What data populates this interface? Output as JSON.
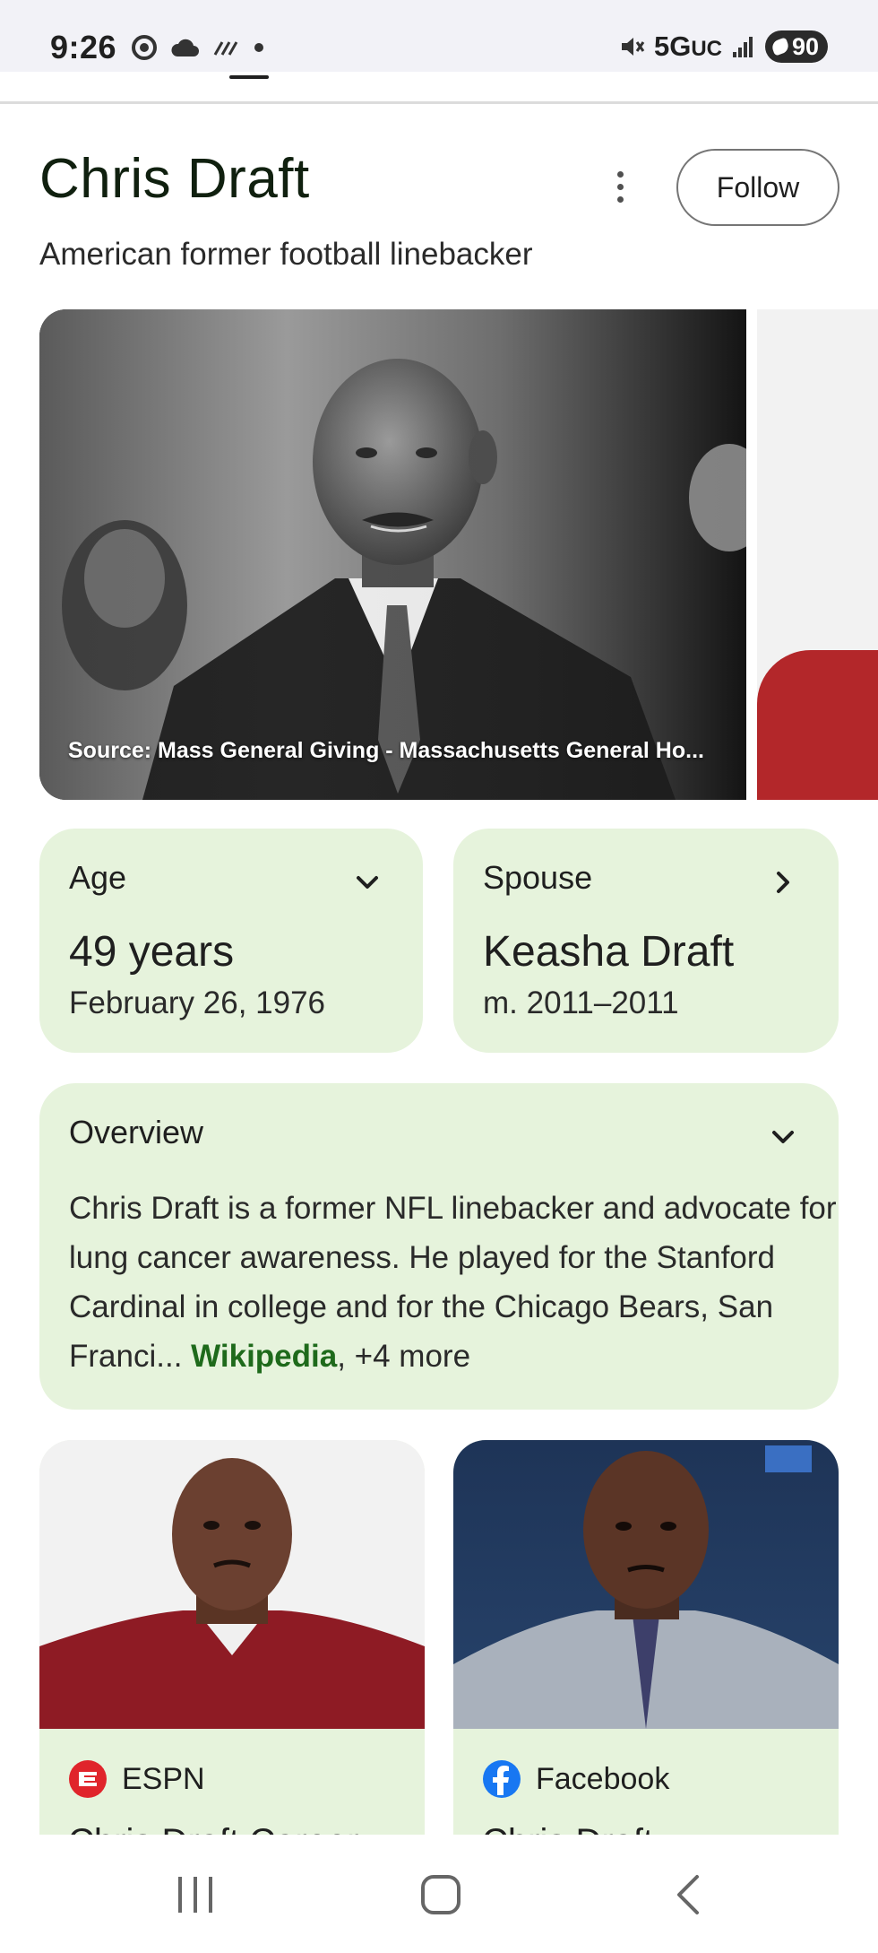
{
  "status_bar": {
    "time": "9:26",
    "network": "5G",
    "network_suffix": "UC",
    "battery": "90"
  },
  "entity": {
    "title": "Chris Draft",
    "subtitle": "American former football linebacker",
    "follow_label": "Follow"
  },
  "hero": {
    "caption": "Source: Mass General Giving - Massachusetts General Ho..."
  },
  "cards": {
    "age": {
      "label": "Age",
      "value": "49 years",
      "sub": "February 26, 1976"
    },
    "spouse": {
      "label": "Spouse",
      "value": "Keasha Draft",
      "sub": "m. 2011–2011"
    },
    "overview": {
      "label": "Overview",
      "text": "Chris Draft is a former NFL linebacker and advocate for lung cancer awareness. He played for the Stanford Cardinal in college and for the Chicago Bears, San Franci",
      "ellipsis": "... ",
      "link": "Wikipedia",
      "more": ", +4 more"
    }
  },
  "results": [
    {
      "source": "ESPN",
      "title": "Chris Draft Career",
      "icon": "espn-icon"
    },
    {
      "source": "Facebook",
      "title": "Chris Draft",
      "icon": "facebook-icon"
    }
  ],
  "colors": {
    "card_bg": "#e6f3dc",
    "link_green": "#1e6a1b",
    "espn_red": "#e0242b",
    "facebook_blue": "#1877f2"
  }
}
